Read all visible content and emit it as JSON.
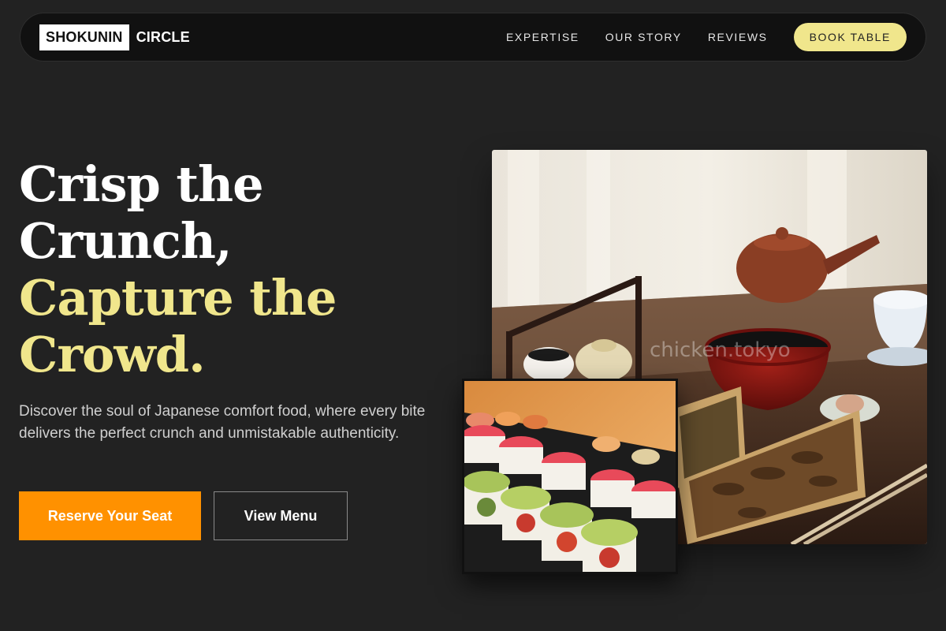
{
  "nav": {
    "logo_box": "SHOKUNIN",
    "logo_text": "CIRCLE",
    "links": [
      "EXPERTISE",
      "OUR STORY",
      "REVIEWS"
    ],
    "cta": "BOOK TABLE"
  },
  "hero": {
    "headline_lines": [
      "Crisp the",
      "Crunch,",
      "Capture the",
      "Crowd."
    ],
    "subtext": "Discover the soul of Japanese comfort food, where every bite delivers the perfect crunch and unmistakable authenticity.",
    "primary_button": "Reserve Your Seat",
    "secondary_button": "View Menu"
  },
  "images": {
    "main_watermark": "chicken.tokyo"
  },
  "colors": {
    "background": "#222222",
    "accent_gold": "#f0e68c",
    "accent_orange": "#ff9100"
  }
}
